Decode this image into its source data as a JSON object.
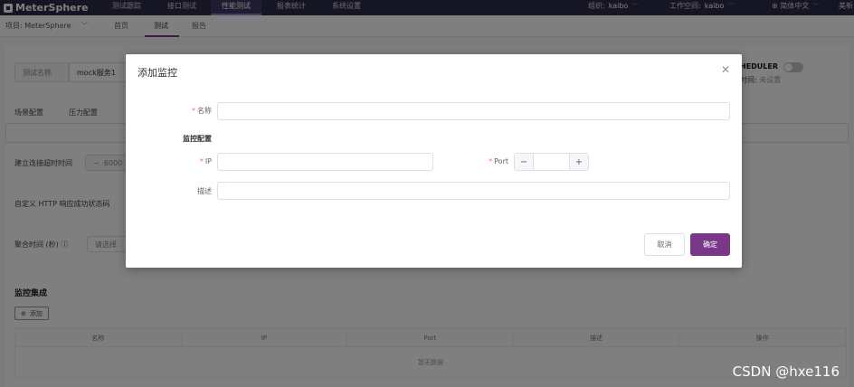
{
  "topnav": {
    "brand": "MeterSphere",
    "items": [
      {
        "label": "测试跟踪",
        "active": false
      },
      {
        "label": "接口测试",
        "active": false
      },
      {
        "label": "性能测试",
        "active": true
      },
      {
        "label": "报表统计",
        "active": false
      },
      {
        "label": "系统设置",
        "active": false
      }
    ],
    "org_label": "组织:",
    "org_value": "kaibo",
    "workspace_label": "工作空间:",
    "workspace_value": "kaibo",
    "language": "简体中文",
    "user_trunc": "美新"
  },
  "subbar": {
    "project": "项目: MeterSphere",
    "tabs": [
      "首页",
      "测试",
      "报告"
    ]
  },
  "background": {
    "test_name_label": "测试名称",
    "test_name_value": "mock服务1",
    "tabs": [
      "场景配置",
      "压力配置"
    ],
    "scheduler_label": "HEDULER",
    "next_time_label": "时间:",
    "next_time_value": "未设置",
    "connect_timeout_label": "建立连接超时时间",
    "connect_timeout_value": "6000",
    "http_code_label": "自定义 HTTP 响应成功状态码",
    "agg_time_label": "聚合时间 (秒)",
    "agg_time_placeholder": "请选择",
    "monitor_section": "监控集成",
    "add_button": "添加",
    "table_headers": [
      "名称",
      "IP",
      "Port",
      "描述",
      "操作"
    ],
    "table_empty": "暂无数据"
  },
  "dialog": {
    "title": "添加监控",
    "name_label": "名称",
    "monitor_config": "监控配置",
    "ip_label": "IP",
    "port_label": "Port",
    "desc_label": "描述",
    "cancel": "取消",
    "confirm": "确定"
  },
  "watermark": "CSDN @hxe116",
  "colors": {
    "primary": "#783887",
    "nav_bg": "#2c2a48",
    "required": "#f56c6c"
  }
}
